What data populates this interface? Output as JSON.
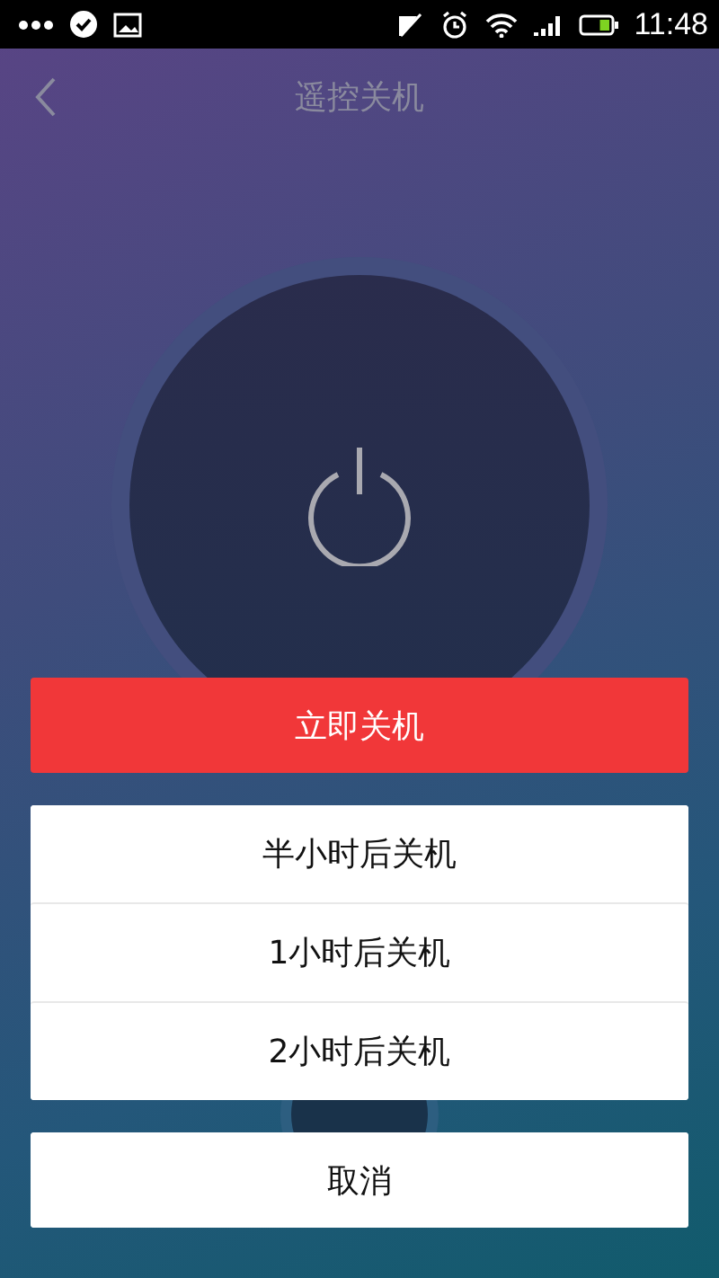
{
  "status_bar": {
    "time": "11:48"
  },
  "header": {
    "title": "遥控关机"
  },
  "actions": [
    {
      "label": "立即关机",
      "kind": "primary"
    },
    {
      "label": "半小时后关机",
      "kind": "option"
    },
    {
      "label": "1小时后关机",
      "kind": "option"
    },
    {
      "label": "2小时后关机",
      "kind": "option"
    }
  ],
  "cancel": {
    "label": "取消"
  }
}
